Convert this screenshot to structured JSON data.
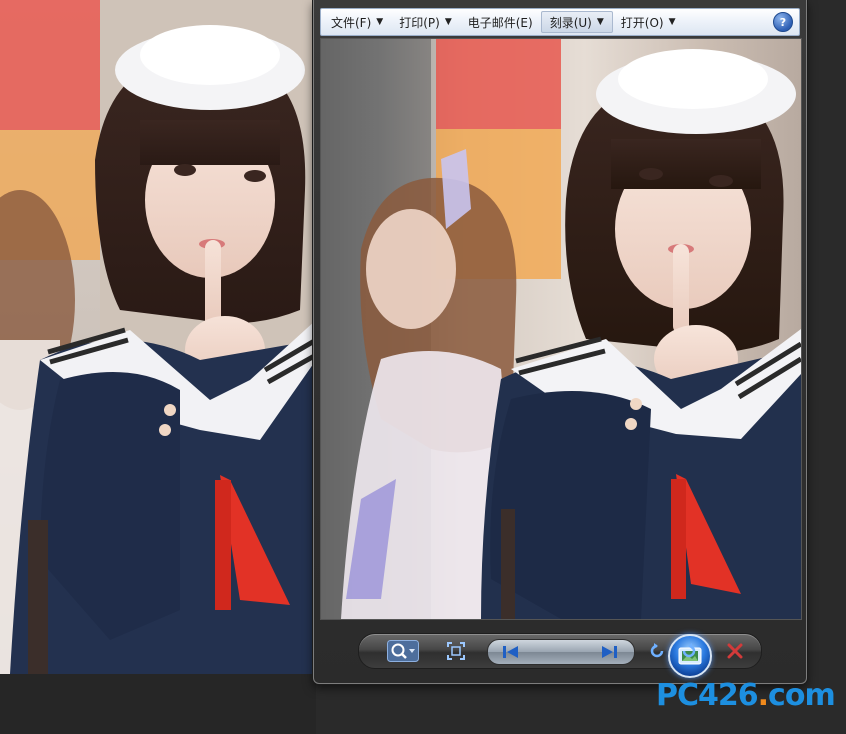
{
  "menu": {
    "items": [
      {
        "label": "文件(F)",
        "has_arrow": true
      },
      {
        "label": "打印(P)",
        "has_arrow": true
      },
      {
        "label": "电子邮件(E)",
        "has_arrow": false
      },
      {
        "label": "刻录(U)",
        "has_arrow": true
      },
      {
        "label": "打开(O)",
        "has_arrow": true
      }
    ],
    "help_label": "?"
  },
  "toolbar": {
    "zoom": "magnifier-icon",
    "fit": "actual-size-icon",
    "previous": "previous-icon",
    "slideshow": "slideshow-icon",
    "next": "next-icon",
    "rotate_ccw": "rotate-counterclockwise-icon",
    "rotate_cw": "rotate-clockwise-icon",
    "delete": "delete-icon"
  },
  "watermark": {
    "main": "PC426",
    "dot": ".",
    "tail": "com"
  },
  "colors": {
    "accent_blue": "#2b7ae0",
    "delete_red": "#d23a3a",
    "watermark_blue": "#1d8fe0",
    "watermark_orange": "#f08a1c"
  }
}
